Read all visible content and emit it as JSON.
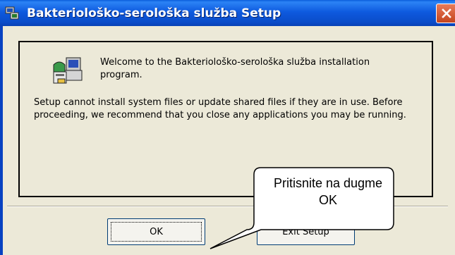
{
  "window": {
    "title": "Bakteriološko-serološka služba Setup",
    "close_icon": "close-icon",
    "app_icon": "setup-app-icon"
  },
  "dialog": {
    "welcome": "Welcome to the Bakteriološko-serološka služba installation program.",
    "body": "Setup cannot install system files or update shared files if they are in use. Before proceeding, we recommend that you close any applications you may be running.",
    "icon": "computer-setup-icon"
  },
  "buttons": {
    "ok": "OK",
    "exit": "Exit Setup"
  },
  "annotation": {
    "text": "Pritisnite na dugme OK"
  },
  "colors": {
    "titlebar": "#0A5EDB",
    "dialog_bg": "#ECE9D8",
    "close": "#D9542E"
  }
}
